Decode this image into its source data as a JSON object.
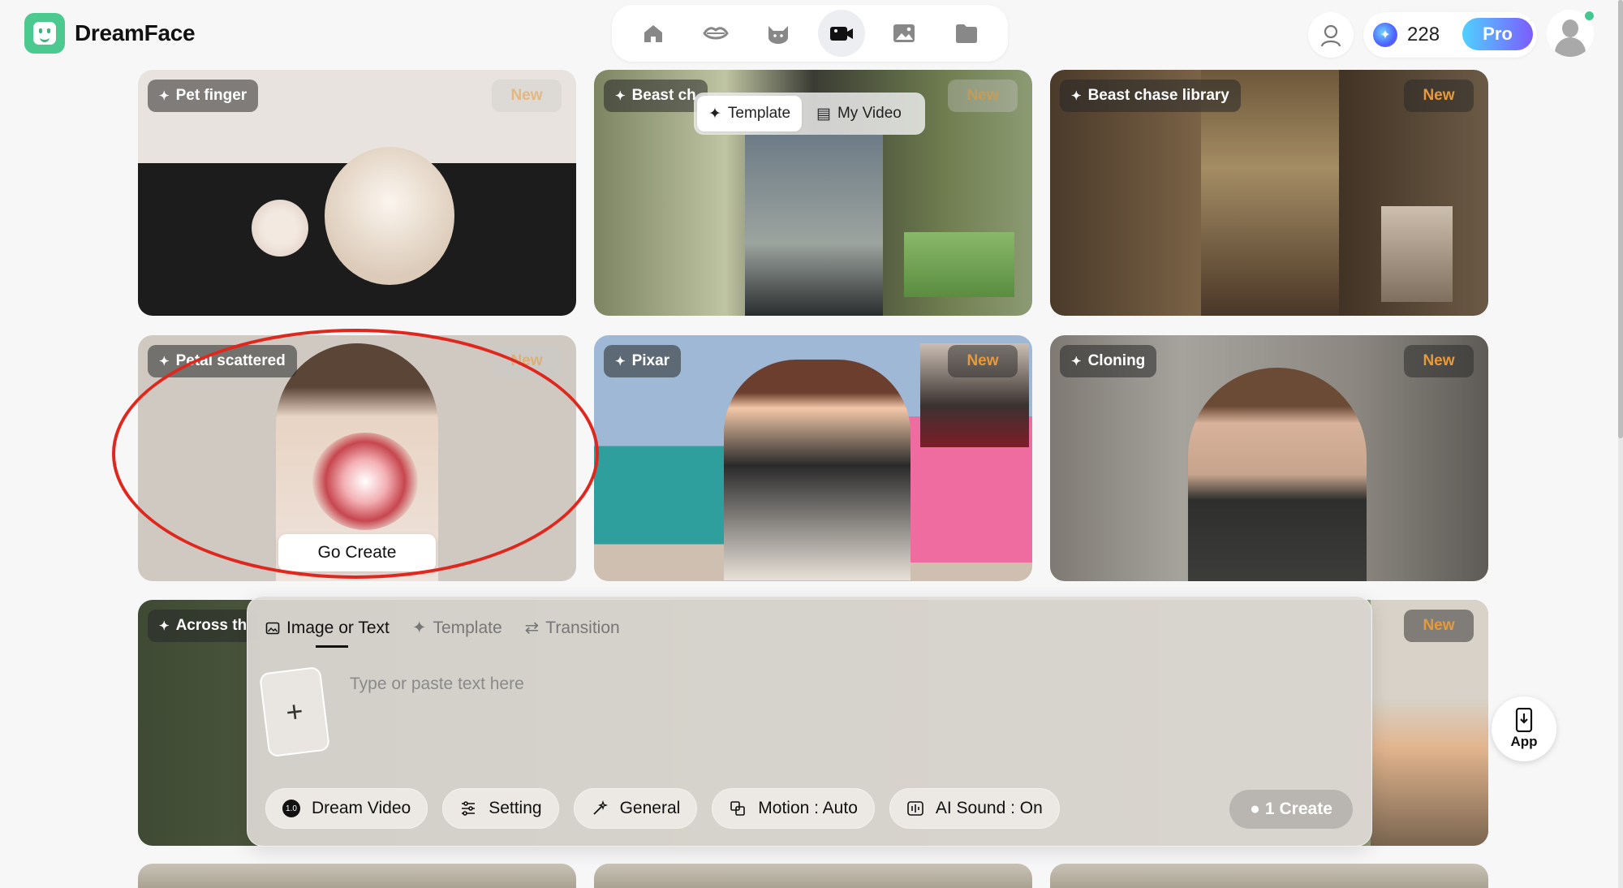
{
  "app": {
    "name": "DreamFace",
    "brand_color": "#4cc98f"
  },
  "topnav": {
    "items": [
      {
        "name": "home",
        "icon": "home-icon"
      },
      {
        "name": "lips",
        "icon": "lips-icon"
      },
      {
        "name": "pet",
        "icon": "cat-icon"
      },
      {
        "name": "video",
        "icon": "video-camera-icon",
        "active": true
      },
      {
        "name": "image",
        "icon": "image-icon"
      },
      {
        "name": "folder",
        "icon": "folder-icon"
      }
    ]
  },
  "header": {
    "credits": "228",
    "pro_label": "Pro"
  },
  "video_source_toggle": {
    "template": "Template",
    "my_video": "My Video",
    "selected": "Template"
  },
  "cards": [
    {
      "title": "Pet finger",
      "badge": "New"
    },
    {
      "title": "Beast ch",
      "badge": "New"
    },
    {
      "title": "Beast chase library",
      "badge": "New"
    },
    {
      "title": "Petal scattered",
      "badge": "New",
      "action": "Go Create"
    },
    {
      "title": "Pixar",
      "badge": "New"
    },
    {
      "title": "Cloning",
      "badge": "New"
    },
    {
      "title": "Across th",
      "badge": "New"
    }
  ],
  "composer": {
    "tabs": [
      {
        "label": "Image or Text",
        "icon": "image-icon",
        "active": true
      },
      {
        "label": "Template",
        "icon": "sparkle-icon"
      },
      {
        "label": "Transition",
        "icon": "transition-icon"
      }
    ],
    "placeholder": "Type or paste text here",
    "upload_symbol": "+",
    "options": {
      "model_version": "1.0",
      "model": "Dream Video",
      "setting": "Setting",
      "style": "General",
      "motion": "Motion : Auto",
      "ai_sound": "AI Sound : On"
    },
    "create_cost": "1",
    "create_label": "Create"
  },
  "app_download": {
    "label": "App"
  },
  "annotation": {
    "color": "#e0271d"
  }
}
